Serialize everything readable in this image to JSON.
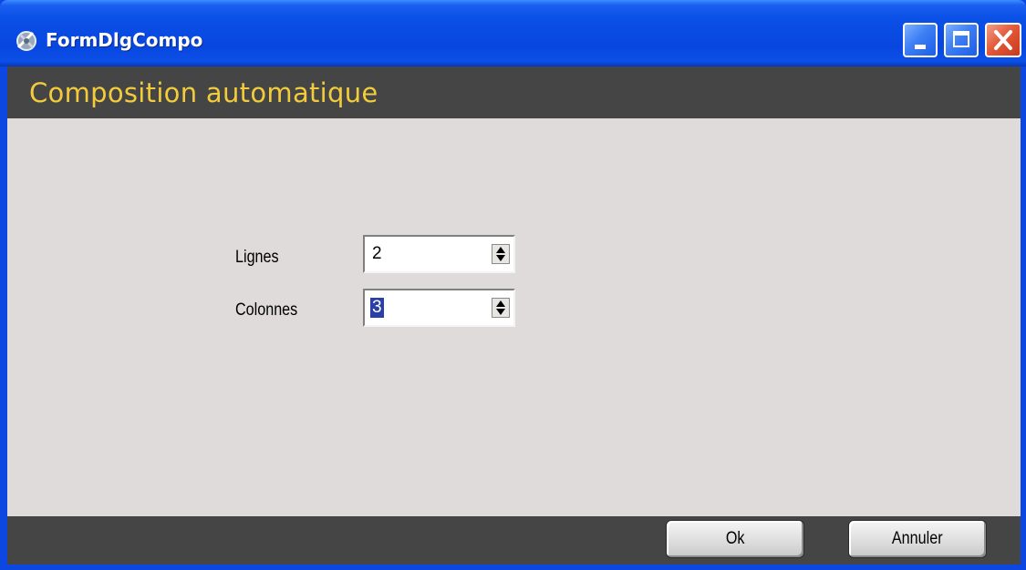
{
  "window": {
    "title": "FormDlgCompo",
    "controls": {
      "minimize": "minimize-icon",
      "maximize": "maximize-icon",
      "close": "close-icon"
    }
  },
  "header": {
    "title": "Composition automatique",
    "title_color": "#f2cc3a",
    "background": "#454545"
  },
  "form": {
    "rows_label": "Lignes",
    "rows_value": "2",
    "cols_label": "Colonnes",
    "cols_value": "3"
  },
  "footer": {
    "ok_label": "Ok",
    "cancel_label": "Annuler"
  }
}
